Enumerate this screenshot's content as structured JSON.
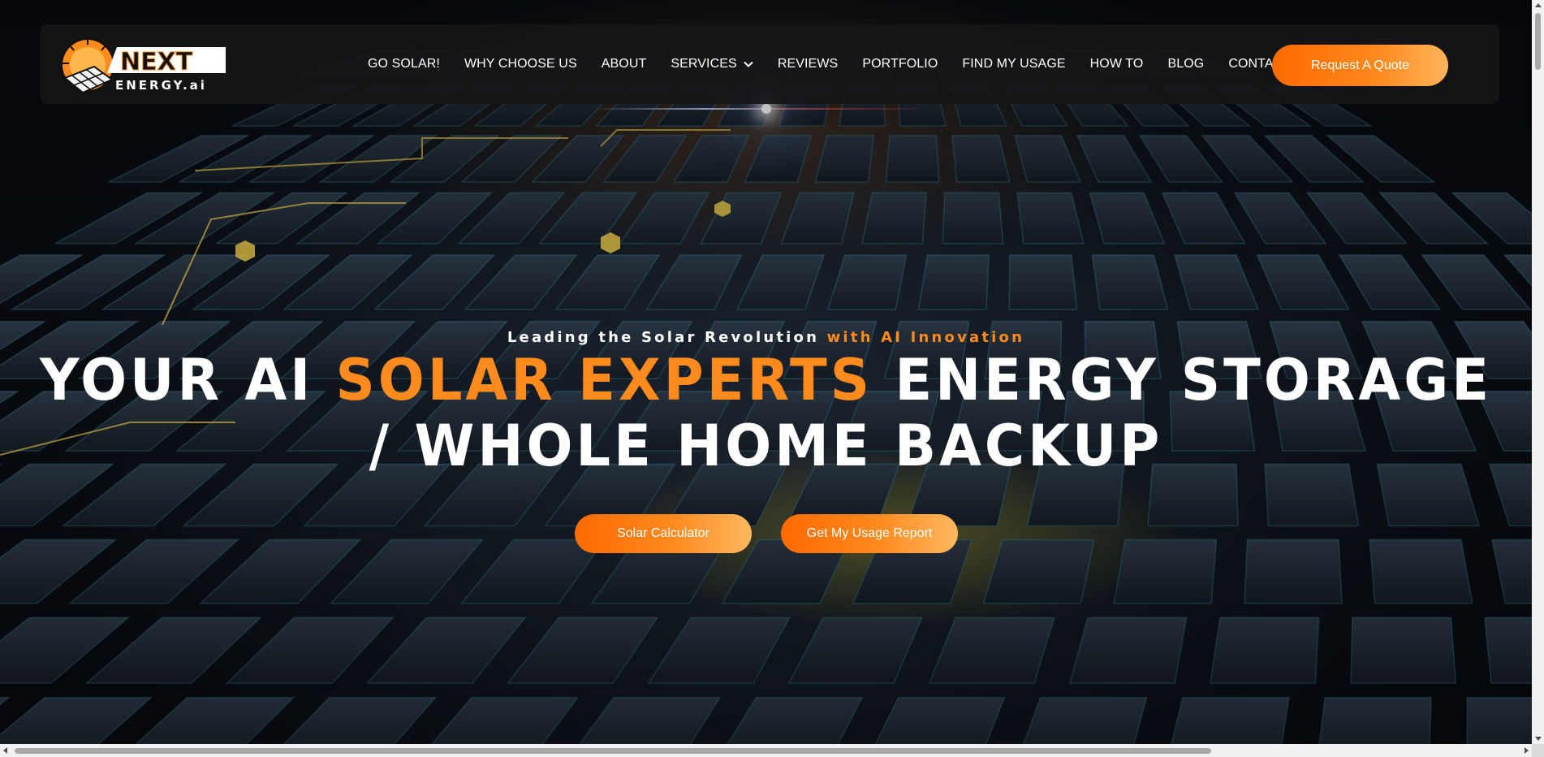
{
  "brand": {
    "logo_main": "NEXT",
    "logo_sub": "ENERGY.ai",
    "logo_icon": "sun-solar-panel-icon"
  },
  "nav": {
    "items": [
      {
        "label": "GO SOLAR!"
      },
      {
        "label": "WHY CHOOSE US"
      },
      {
        "label": "ABOUT"
      },
      {
        "label": "SERVICES",
        "icon": "chevron-down-icon"
      },
      {
        "label": "REVIEWS"
      },
      {
        "label": "PORTFOLIO"
      },
      {
        "label": "FIND MY USAGE"
      },
      {
        "label": "HOW TO"
      },
      {
        "label": "BLOG"
      },
      {
        "label": "CONTACT US"
      }
    ],
    "quote_button": "Request A Quote"
  },
  "hero": {
    "tagline_main": "Leading the Solar Revolution",
    "tagline_accent": "with AI Innovation",
    "headline_part1": "YOUR AI",
    "headline_accent": "SOLAR EXPERTS",
    "headline_part2": "ENERGY STORAGE",
    "headline_line2": "/ WHOLE HOME BACKUP",
    "cta_primary": "Solar Calculator",
    "cta_secondary": "Get My Usage Report"
  },
  "colors": {
    "accent": "#ff8a1e",
    "header_bg": "#161618",
    "button_gradient_start": "#ff6a00",
    "button_gradient_end": "#ffb45a"
  }
}
